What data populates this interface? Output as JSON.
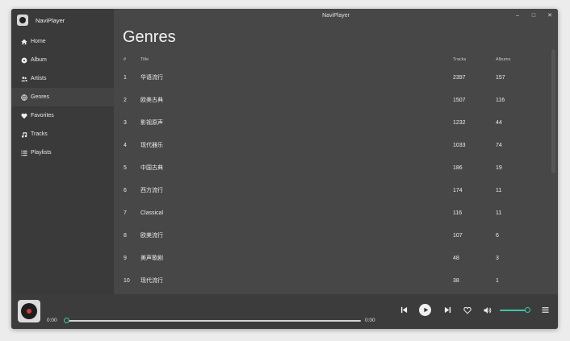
{
  "window": {
    "title": "NaviPlayer",
    "controls": [
      "–",
      "□",
      "✕"
    ]
  },
  "sidebar": {
    "app_name": "NaviPlayer",
    "items": [
      {
        "label": "Home",
        "icon": "home-icon",
        "active": false
      },
      {
        "label": "Album",
        "icon": "album-icon",
        "active": false
      },
      {
        "label": "Artists",
        "icon": "artists-icon",
        "active": false
      },
      {
        "label": "Genres",
        "icon": "genres-icon",
        "active": true
      },
      {
        "label": "Favorites",
        "icon": "heart-icon",
        "active": false
      },
      {
        "label": "Tracks",
        "icon": "music-note-icon",
        "active": false
      },
      {
        "label": "Playlists",
        "icon": "playlist-icon",
        "active": false
      }
    ]
  },
  "main": {
    "page_title": "Genres",
    "columns": {
      "num": "#",
      "title": "Title",
      "tracks": "Tracks",
      "albums": "Albums"
    },
    "rows": [
      {
        "num": "1",
        "title": "华语流行",
        "tracks": "2397",
        "albums": "157"
      },
      {
        "num": "2",
        "title": "欧美古典",
        "tracks": "1507",
        "albums": "116"
      },
      {
        "num": "3",
        "title": "影视原声",
        "tracks": "1232",
        "albums": "44"
      },
      {
        "num": "4",
        "title": "现代器乐",
        "tracks": "1033",
        "albums": "74"
      },
      {
        "num": "5",
        "title": "中国古典",
        "tracks": "186",
        "albums": "19"
      },
      {
        "num": "6",
        "title": "西方流行",
        "tracks": "174",
        "albums": "11"
      },
      {
        "num": "7",
        "title": "Classical",
        "tracks": "116",
        "albums": "11"
      },
      {
        "num": "8",
        "title": "欧美流行",
        "tracks": "107",
        "albums": "6"
      },
      {
        "num": "9",
        "title": "美声歌剧",
        "tracks": "48",
        "albums": "3"
      },
      {
        "num": "10",
        "title": "现代流行",
        "tracks": "38",
        "albums": "1"
      }
    ]
  },
  "player": {
    "elapsed": "0:00",
    "duration": "0:00",
    "progress": 0,
    "volume": 0.9,
    "accent_color": "#3ec7a9"
  }
}
